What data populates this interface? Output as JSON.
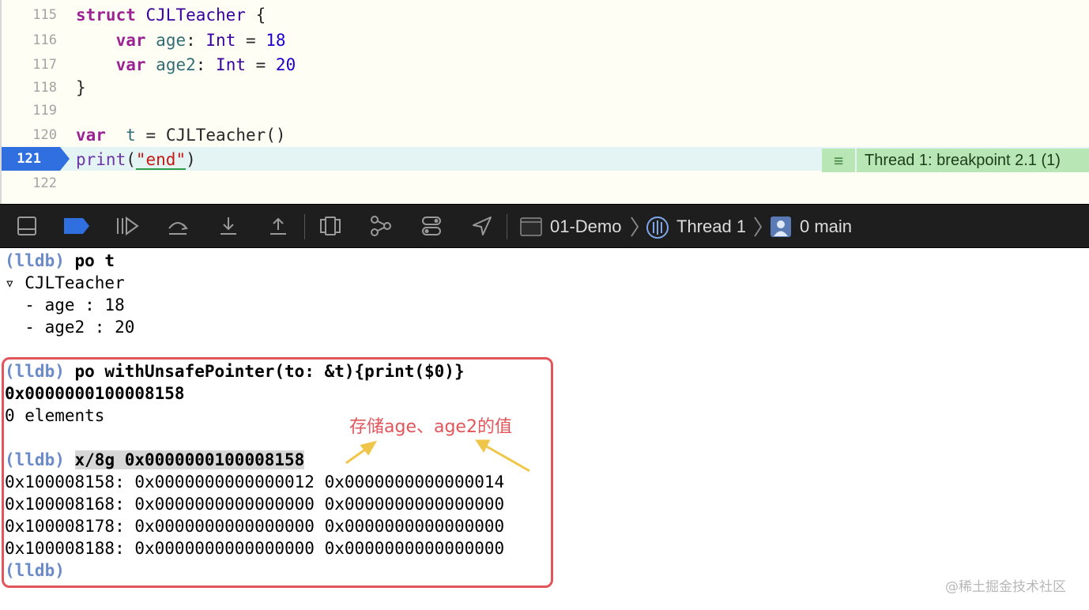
{
  "editor": {
    "lines": [
      {
        "num": "115",
        "tokens": [
          [
            "kw",
            "struct"
          ],
          [
            "",
            " "
          ],
          [
            "ty",
            "CJLTeacher"
          ],
          [
            "",
            " {"
          ]
        ]
      },
      {
        "num": "116",
        "tokens": [
          [
            "",
            "    "
          ],
          [
            "kw",
            "var"
          ],
          [
            "",
            " "
          ],
          [
            "prop",
            "age"
          ],
          [
            "",
            ": "
          ],
          [
            "ty",
            "Int"
          ],
          [
            "",
            " = "
          ],
          [
            "num",
            "18"
          ]
        ]
      },
      {
        "num": "117",
        "tokens": [
          [
            "",
            "    "
          ],
          [
            "kw",
            "var"
          ],
          [
            "",
            " "
          ],
          [
            "prop",
            "age2"
          ],
          [
            "",
            ": "
          ],
          [
            "ty",
            "Int"
          ],
          [
            "",
            " = "
          ],
          [
            "num",
            "20"
          ]
        ]
      },
      {
        "num": "118",
        "tokens": [
          [
            "",
            "}"
          ]
        ]
      },
      {
        "num": "119",
        "tokens": []
      },
      {
        "num": "120",
        "tokens": [
          [
            "kw",
            "var"
          ],
          [
            "",
            "  "
          ],
          [
            "prop",
            "t"
          ],
          [
            "",
            " = CJLTeacher()"
          ]
        ]
      },
      {
        "num": "121",
        "tokens": [
          [
            "fn",
            "print"
          ],
          [
            "",
            "("
          ],
          [
            "str",
            "\"end\""
          ],
          [
            "",
            ")"
          ]
        ]
      },
      {
        "num": "122",
        "tokens": []
      }
    ],
    "current_line": "121",
    "thread_badge": "Thread 1: breakpoint 2.1 (1)"
  },
  "toolbar": {
    "crumbs": [
      "01-Demo",
      "Thread 1",
      "0 main"
    ]
  },
  "console": {
    "lines": [
      {
        "segments": [
          [
            "prompt",
            "(lldb)"
          ],
          [
            "bold",
            " po t"
          ]
        ]
      },
      {
        "segments": [
          [
            "",
            "▿ CJLTeacher"
          ]
        ]
      },
      {
        "segments": [
          [
            "",
            "  - age : 18"
          ]
        ]
      },
      {
        "segments": [
          [
            "",
            "  - age2 : 20"
          ]
        ]
      },
      {
        "segments": []
      },
      {
        "segments": [
          [
            "prompt",
            "(lldb)"
          ],
          [
            "bold",
            " po withUnsafePointer(to: &t){print($0)}"
          ]
        ]
      },
      {
        "segments": [
          [
            "bold",
            "0x0000000100008158"
          ]
        ]
      },
      {
        "segments": [
          [
            "",
            "0 elements"
          ]
        ]
      },
      {
        "segments": []
      },
      {
        "segments": [
          [
            "prompt",
            "(lldb)"
          ],
          [
            "",
            " "
          ],
          [
            "bold hl",
            "x/8g 0x0000000100008158"
          ]
        ]
      },
      {
        "segments": [
          [
            "",
            "0x100008158: 0x0000000000000012 0x0000000000000014"
          ]
        ]
      },
      {
        "segments": [
          [
            "",
            "0x100008168: 0x0000000000000000 0x0000000000000000"
          ]
        ]
      },
      {
        "segments": [
          [
            "",
            "0x100008178: 0x0000000000000000 0x0000000000000000"
          ]
        ]
      },
      {
        "segments": [
          [
            "",
            "0x100008188: 0x0000000000000000 0x0000000000000000"
          ]
        ]
      },
      {
        "segments": [
          [
            "prompt",
            "(lldb)"
          ]
        ]
      }
    ],
    "annotation": "存储age、age2的值"
  },
  "watermark": "@稀土掘金技术社区",
  "colors": {
    "breakpoint": "#2f6fe0",
    "annotation_red": "#e2555a",
    "arrow_yellow": "#f0c64a",
    "badge_green": "#b9e6b5"
  }
}
